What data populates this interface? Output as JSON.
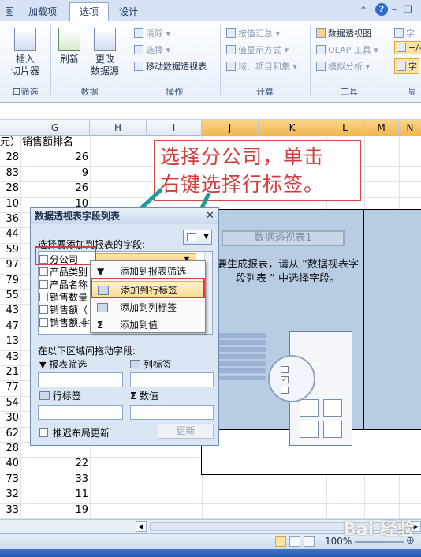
{
  "tabs": [
    "图",
    "加载项",
    "选项",
    "设计"
  ],
  "ribbon": {
    "insert_slicer": "插入\n切片器",
    "refresh": "刷新",
    "change_source": "更改\n数据源",
    "clear": "清除",
    "select": "选择",
    "move_pivot": "移动数据透视表",
    "by_value_summary": "按值汇总",
    "value_display": "值显示方式",
    "fields_items": "域、项目和集",
    "pivot_chart": "数据透视图",
    "olap_tools": "OLAP 工具",
    "what_if": "模拟分析",
    "right_field": "字",
    "right_plus": "+/-",
    "right_field2": "字",
    "groups": {
      "filter": "口筛选",
      "data": "数据",
      "actions": "操作",
      "calc": "计算",
      "tools": "工具",
      "show": "显"
    }
  },
  "columns": [
    "G",
    "H",
    "I",
    "J",
    "K",
    "L",
    "M",
    "N"
  ],
  "f_column_partial": [
    "元）",
    "28",
    "83",
    "28",
    "10",
    "36",
    "44",
    "59",
    "97",
    "79",
    "55",
    "43",
    "47",
    "13",
    "43",
    "21",
    "77",
    "54",
    "30",
    "62",
    "28",
    "40",
    "73",
    "32",
    "33",
    "31"
  ],
  "g_column": [
    "销售额排名",
    "26",
    "9",
    "26",
    "10",
    "",
    "",
    "",
    "",
    "",
    "",
    "",
    "",
    "",
    "",
    "",
    "",
    "",
    "",
    "",
    "",
    "22",
    "33",
    "11",
    "19",
    "35"
  ],
  "annotation": "选择分公司，单击\n右键选择行标签。",
  "pivot": {
    "name": "数据透视表1",
    "message": "要生成报表，请从 “数据视表字段列表 ” 中选择字段。"
  },
  "field_panel": {
    "title": "数据透视表字段列表",
    "choose_label": "选择要添加到报表的字段:",
    "fields": [
      "分公司",
      "产品类别",
      "产品名称",
      "销售数量",
      "销售额（",
      "销售额排名"
    ],
    "drag_label": "在以下区域间拖动字段:",
    "report_filter": "报表筛选",
    "column_labels": "列标签",
    "row_labels": "行标签",
    "values": "数值",
    "defer_update": "推迟布局更新",
    "update_button": "更新"
  },
  "context_menu": [
    {
      "label": "添加到报表筛选",
      "icon": "filter-icon"
    },
    {
      "label": "添加到行标签",
      "icon": "row-labels-icon"
    },
    {
      "label": "添加到列标签",
      "icon": "column-labels-icon"
    },
    {
      "label": "添加到值",
      "icon": "sigma-icon"
    }
  ],
  "statusbar": {
    "zoom": "100%"
  },
  "watermark": "Bai 经验"
}
